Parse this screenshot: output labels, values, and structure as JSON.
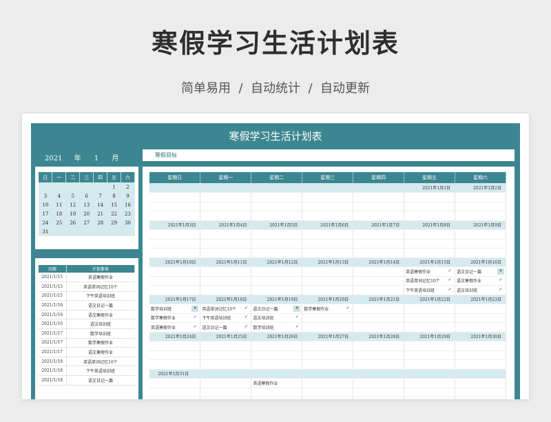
{
  "banner": {
    "title": "寒假学习生活计划表",
    "subtitle": "简单易用  /  自动统计  /  自动更新"
  },
  "sheet": {
    "title": "寒假学习生活计划表",
    "year": "2021",
    "year_label": "年",
    "month": "1",
    "month_label": "月",
    "goal_label": "寒假目标"
  },
  "mini_calendar": {
    "headers": [
      "日",
      "一",
      "二",
      "三",
      "四",
      "五",
      "六"
    ],
    "weeks": [
      [
        "",
        "",
        "",
        "",
        "",
        "1",
        "2"
      ],
      [
        "3",
        "4",
        "5",
        "6",
        "7",
        "8",
        "9"
      ],
      [
        "10",
        "11",
        "12",
        "13",
        "14",
        "15",
        "16"
      ],
      [
        "17",
        "18",
        "19",
        "20",
        "21",
        "22",
        "23"
      ],
      [
        "24",
        "25",
        "26",
        "27",
        "28",
        "29",
        "30"
      ],
      [
        "31",
        "",
        "",
        "",
        "",
        "",
        ""
      ]
    ]
  },
  "plan_list": {
    "headers": [
      "日期",
      "计划事项"
    ],
    "rows": [
      [
        "2021/1/15",
        "英语寒假作业"
      ],
      [
        "2021/1/15",
        "英语单词记忆10个"
      ],
      [
        "2021/1/15",
        "下午英语培训班"
      ],
      [
        "2021/1/16",
        "语文日记一篇"
      ],
      [
        "2021/1/16",
        "语文寒假作业"
      ],
      [
        "2021/1/16",
        "语文培训班"
      ],
      [
        "2021/1/17",
        "数学培训班"
      ],
      [
        "2021/1/17",
        "数学寒假作业"
      ],
      [
        "2021/1/17",
        "语文寒假作业"
      ],
      [
        "2021/1/18",
        "英语单词记忆10个"
      ],
      [
        "2021/1/18",
        "下午英语培训班"
      ],
      [
        "2021/1/18",
        "语文日记一篇"
      ]
    ]
  },
  "main_calendar": {
    "headers": [
      "星期日",
      "星期一",
      "星期二",
      "星期三",
      "星期四",
      "星期五",
      "星期六"
    ],
    "weeks": [
      {
        "dates": [
          "",
          "",
          "",
          "",
          "",
          "2021年1月1日",
          "2021年1月2日"
        ],
        "tasks": [
          [
            [],
            [],
            [],
            [],
            [],
            [],
            []
          ]
        ]
      },
      {
        "dates": [
          "2021年1月3日",
          "2021年1月4日",
          "2021年1月5日",
          "2021年1月6日",
          "2021年1月7日",
          "2021年1月8日",
          "2021年1月9日"
        ],
        "tasks": [
          [
            [],
            [],
            [],
            [],
            [],
            [],
            []
          ]
        ]
      },
      {
        "dates": [
          "2021年1月10日",
          "2021年1月11日",
          "2021年1月12日",
          "2021年1月13日",
          "2021年1月14日",
          "2021年1月15日",
          "2021年1月16日"
        ],
        "tasks": [
          [
            [],
            [],
            [],
            [],
            [],
            [
              "英语寒假作业",
              "✓"
            ],
            [
              "语文日记一篇",
              "✕"
            ]
          ],
          [
            [],
            [],
            [],
            [],
            [],
            [
              "英语单词记忆10个",
              "✓"
            ],
            [
              "语文寒假作业",
              "✓"
            ]
          ],
          [
            [],
            [],
            [],
            [],
            [],
            [
              "下午英语培训班",
              "✓"
            ],
            [
              "语文培训班",
              "✓"
            ]
          ]
        ]
      },
      {
        "dates": [
          "2021年1月17日",
          "2021年1月18日",
          "2021年1月19日",
          "2021年1月20日",
          "2021年1月21日",
          "2021年1月22日",
          "2021年1月23日"
        ],
        "tasks": [
          [
            [
              "数学培训班",
              "✕"
            ],
            [
              "英语单词记忆10个",
              "✓"
            ],
            [
              "语文日记一篇",
              "✕"
            ],
            [
              "数学寒假作业",
              "✓"
            ],
            [],
            [],
            []
          ],
          [
            [
              "数学寒假作业",
              "✓"
            ],
            [
              "下午英语培训班",
              "✓"
            ],
            [
              "语文培训班",
              "✓"
            ],
            [],
            [],
            [],
            []
          ],
          [
            [
              "英语寒假作业",
              "✓"
            ],
            [
              "语文日记一篇",
              "✓"
            ],
            [
              "数学培训班",
              "✓"
            ],
            [],
            [],
            [],
            []
          ]
        ]
      },
      {
        "dates": [
          "2021年1月24日",
          "2021年1月25日",
          "2021年1月26日",
          "2021年1月27日",
          "2021年1月28日",
          "2021年1月29日",
          "2021年1月30日"
        ],
        "tasks": [
          [
            [],
            [],
            [],
            [],
            [],
            [],
            []
          ],
          [
            [],
            [],
            [],
            [],
            [],
            [],
            []
          ],
          [
            [],
            [],
            [],
            [],
            [],
            [],
            []
          ]
        ]
      },
      {
        "dates": [
          "2021年1月31日",
          "",
          "",
          "",
          "",
          "",
          ""
        ],
        "tasks": [
          [
            [],
            [],
            [
              "英语寒假作业",
              ""
            ],
            [],
            [],
            [],
            []
          ]
        ]
      }
    ]
  }
}
